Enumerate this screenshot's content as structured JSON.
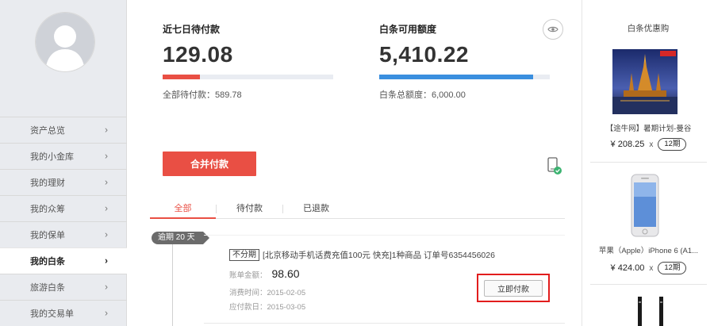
{
  "sidebar": {
    "menu": [
      {
        "label": "资产总览"
      },
      {
        "label": "我的小金库"
      },
      {
        "label": "我的理财"
      },
      {
        "label": "我的众筹"
      },
      {
        "label": "我的保单"
      },
      {
        "label": "我的白条"
      },
      {
        "label": "旅游白条"
      },
      {
        "label": "我的交易单"
      }
    ],
    "active_index": 5
  },
  "stats": {
    "due7": {
      "label": "近七日待付款",
      "value": "129.08",
      "sub": "全部待付款：589.78",
      "bar_fraction": 0.22,
      "bar_color": "#e94f44"
    },
    "credit": {
      "label": "白条可用额度",
      "value": "5,410.22",
      "sub": "白条总额度：6,000.00",
      "bar_fraction": 0.9,
      "bar_color": "#3a8fdf"
    }
  },
  "actions": {
    "merge_pay": "合并付款"
  },
  "tabs": [
    {
      "label": "全部"
    },
    {
      "label": "待付款"
    },
    {
      "label": "已退款"
    }
  ],
  "order": {
    "overdue": "逾期 20 天",
    "badge": "不分期",
    "title": "[北京移动手机话费充值100元 快充]1种商品 订单号6354456026",
    "amount_label": "账单金额：",
    "amount": "98.60",
    "consume_label": "消费时间：",
    "consume_date": "2015-02-05",
    "due_label": "应付款日：",
    "due_date": "2015-03-05",
    "pay_button": "立即付款"
  },
  "right_panel": {
    "title": "白条优惠购",
    "products": [
      {
        "name": "【途牛网】暑期计划-曼谷",
        "price": "¥ 208.25",
        "x": "x",
        "period": "12期"
      },
      {
        "name": "苹果（Apple）iPhone 6 (A1...",
        "price": "¥ 424.00",
        "x": "x",
        "period": "12期"
      }
    ]
  },
  "colors": {
    "accent": "#e94f44",
    "blue": "#3a8fdf",
    "highlight_box": "#e21d1d"
  }
}
